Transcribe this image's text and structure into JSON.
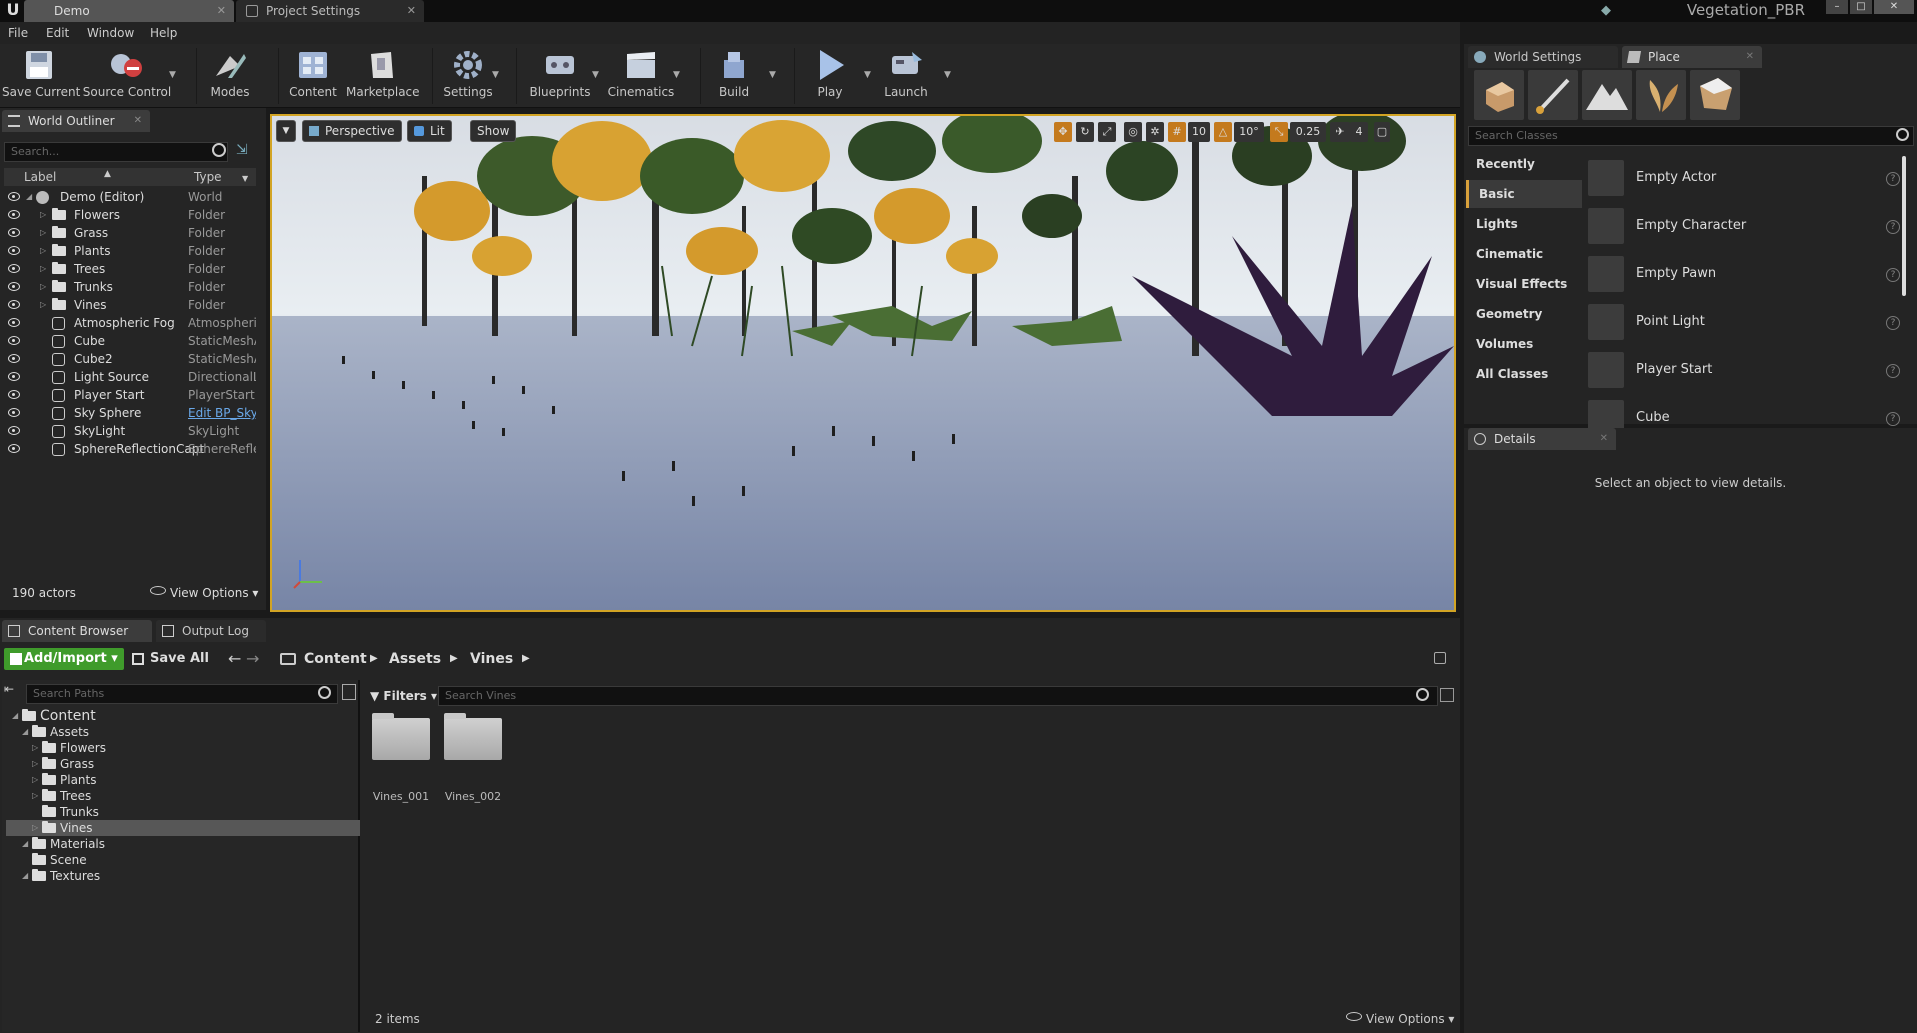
{
  "window": {
    "tabs": [
      {
        "label": "Demo"
      },
      {
        "label": "Project Settings"
      }
    ],
    "project_name": "Vegetation_PBR",
    "controls": [
      "–",
      "□",
      "✕"
    ]
  },
  "menu": [
    "File",
    "Edit",
    "Window",
    "Help"
  ],
  "toolbar": {
    "buttons": [
      {
        "label": "Save Current",
        "icon": "save-icon"
      },
      {
        "label": "Source Control",
        "icon": "source-control-icon"
      },
      {
        "label": "Modes",
        "icon": "modes-icon"
      },
      {
        "label": "Content",
        "icon": "content-icon"
      },
      {
        "label": "Marketplace",
        "icon": "marketplace-icon"
      },
      {
        "label": "Settings",
        "icon": "settings-icon"
      },
      {
        "label": "Blueprints",
        "icon": "blueprints-icon"
      },
      {
        "label": "Cinematics",
        "icon": "cinematics-icon"
      },
      {
        "label": "Build",
        "icon": "build-icon"
      },
      {
        "label": "Play",
        "icon": "play-icon"
      },
      {
        "label": "Launch",
        "icon": "launch-icon"
      }
    ]
  },
  "outliner": {
    "tab_label": "World Outliner",
    "search_placeholder": "Search...",
    "col_label": "Label",
    "col_type": "Type",
    "rows": [
      {
        "label": "Demo (Editor)",
        "type": "World",
        "kind": "world"
      },
      {
        "label": "Flowers",
        "type": "Folder",
        "kind": "folder"
      },
      {
        "label": "Grass",
        "type": "Folder",
        "kind": "folder"
      },
      {
        "label": "Plants",
        "type": "Folder",
        "kind": "folder"
      },
      {
        "label": "Trees",
        "type": "Folder",
        "kind": "folder"
      },
      {
        "label": "Trunks",
        "type": "Folder",
        "kind": "folder"
      },
      {
        "label": "Vines",
        "type": "Folder",
        "kind": "folder"
      },
      {
        "label": "Atmospheric Fog",
        "type": "Atmospheric",
        "kind": "actor"
      },
      {
        "label": "Cube",
        "type": "StaticMeshA",
        "kind": "actor"
      },
      {
        "label": "Cube2",
        "type": "StaticMeshA",
        "kind": "actor"
      },
      {
        "label": "Light Source",
        "type": "DirectionalLi",
        "kind": "actor"
      },
      {
        "label": "Player Start",
        "type": "PlayerStart",
        "kind": "actor"
      },
      {
        "label": "Sky Sphere",
        "type": "Edit BP_Sky",
        "kind": "link"
      },
      {
        "label": "SkyLight",
        "type": "SkyLight",
        "kind": "actor"
      },
      {
        "label": "SphereReflectionCapt",
        "type": "SphereReflec",
        "kind": "actor"
      }
    ],
    "actor_count": "190 actors",
    "view_options": "View Options"
  },
  "viewport": {
    "view_mode": "Perspective",
    "lit": "Lit",
    "show": "Show",
    "grid_snap": "10",
    "rot_snap": "10°",
    "scale_snap": "0.25",
    "camera_speed": "4"
  },
  "place": {
    "tabs": [
      {
        "label": "World Settings"
      },
      {
        "label": "Place"
      }
    ],
    "search_placeholder": "Search Classes",
    "categories": [
      "Recently Placed",
      "Basic",
      "Lights",
      "Cinematic",
      "Visual Effects",
      "Geometry",
      "Volumes",
      "All Classes"
    ],
    "items": [
      {
        "label": "Empty Actor",
        "icon": "sphere-icon"
      },
      {
        "label": "Empty Character",
        "icon": "character-icon"
      },
      {
        "label": "Empty Pawn",
        "icon": "pawn-icon"
      },
      {
        "label": "Point Light",
        "icon": "light-bulb-icon"
      },
      {
        "label": "Player Start",
        "icon": "player-start-icon"
      },
      {
        "label": "Cube",
        "icon": "cube-icon"
      }
    ]
  },
  "details": {
    "tab_label": "Details",
    "empty_message": "Select an object to view details."
  },
  "content_browser": {
    "tabs": [
      {
        "label": "Content Browser"
      },
      {
        "label": "Output Log"
      }
    ],
    "add_import": "Add/Import",
    "save_all": "Save All",
    "path": [
      "Content",
      "Assets",
      "Vines"
    ],
    "search_paths": "Search Paths",
    "filters": "Filters",
    "search_placeholder": "Search Vines",
    "tree": [
      {
        "label": "Content",
        "depth": 0
      },
      {
        "label": "Assets",
        "depth": 1
      },
      {
        "label": "Flowers",
        "depth": 2
      },
      {
        "label": "Grass",
        "depth": 2
      },
      {
        "label": "Plants",
        "depth": 2
      },
      {
        "label": "Trees",
        "depth": 2
      },
      {
        "label": "Trunks",
        "depth": 2
      },
      {
        "label": "Vines",
        "depth": 2
      },
      {
        "label": "Materials",
        "depth": 1
      },
      {
        "label": "Scene",
        "depth": 1
      },
      {
        "label": "Textures",
        "depth": 1
      }
    ],
    "assets": [
      "Vines_001",
      "Vines_002"
    ],
    "item_count": "2 items",
    "view_options": "View Options"
  }
}
